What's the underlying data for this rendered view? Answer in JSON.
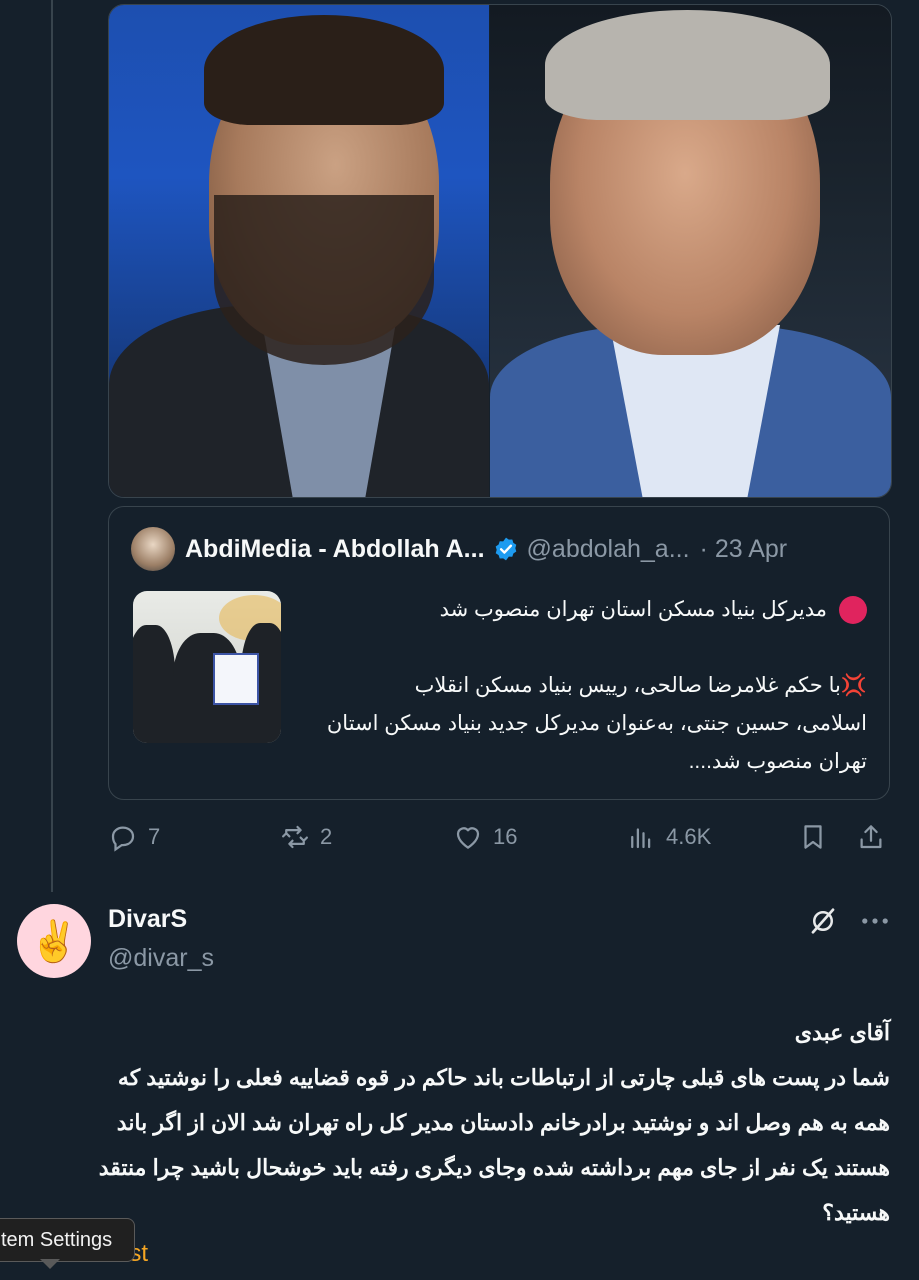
{
  "quoted_tweet": {
    "author_name": "AbdiMedia - Abdollah A...",
    "handle": "@abdolah_a...",
    "date": "· 23 Apr",
    "headline": "مدیرکل بنیاد مسکن استان تهران منصوب شد",
    "body_lines": [
      "💢با حکم غلامرضا صالحی، رییس  بنیاد مسکن انقلاب",
      "اسلامی، حسین جنتی، به‌عنوان مدیرکل جدید بنیاد مسکن  استان",
      "تهران منصوب شد...."
    ]
  },
  "actions": {
    "replies": "7",
    "reposts": "2",
    "likes": "16",
    "views": "4.6K"
  },
  "reply": {
    "name": "DivarS",
    "handle": "@divar_s",
    "avatar_emoji": "✌️",
    "body_lines": [
      "آقای عبدی",
      "شما در پست های قبلی چارتی از ارتباطات باند حاکم در قوه قضاییه فعلی را نوشتید که",
      "همه به هم وصل اند و نوشتید برادرخانم دادستان مدیر کل راه تهران شد الان  از اگر باند",
      "هستند یک نفر از جای مهم برداشته شده وجای دیگری رفته باید خوشحال باشید چرا منتقد",
      "هستید؟"
    ]
  },
  "tooltip": {
    "label": "tem Settings"
  },
  "footer": {
    "repost_link": "ost"
  },
  "colors": {
    "background": "#15202b",
    "border": "#38444d",
    "muted_text": "#8b98a5",
    "verified_blue": "#1d9bf0",
    "alert_red": "#e0245e"
  }
}
